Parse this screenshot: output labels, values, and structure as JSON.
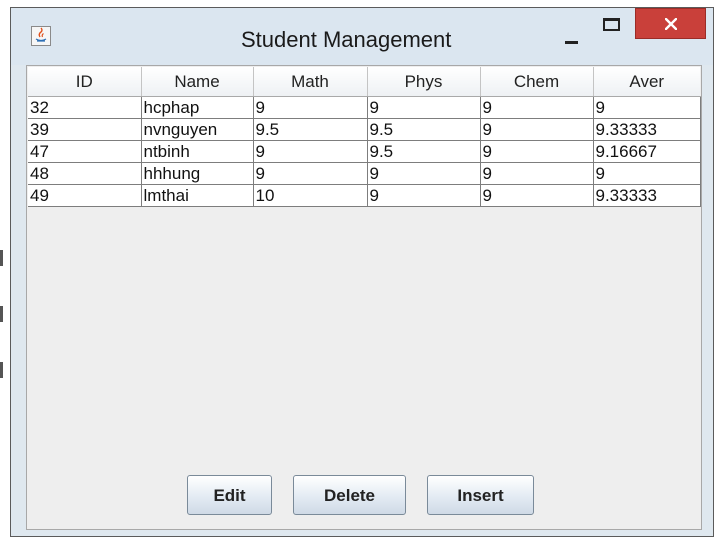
{
  "window": {
    "title": "Student Management",
    "controls": {
      "minimize": "minimize",
      "maximize": "maximize",
      "close": "close"
    }
  },
  "table": {
    "columns": [
      "ID",
      "Name",
      "Math",
      "Phys",
      "Chem",
      "Aver"
    ],
    "rows": [
      [
        "32",
        "hcphap",
        "9",
        "9",
        "9",
        "9"
      ],
      [
        "39",
        "nvnguyen",
        "9.5",
        "9.5",
        "9",
        "9.33333"
      ],
      [
        "47",
        "ntbinh",
        "9",
        "9.5",
        "9",
        "9.16667"
      ],
      [
        "48",
        "hhhung",
        "9",
        "9",
        "9",
        "9"
      ],
      [
        "49",
        "lmthai",
        "10",
        "9",
        "9",
        "9.33333"
      ]
    ]
  },
  "buttons": {
    "edit": "Edit",
    "delete": "Delete",
    "insert": "Insert"
  },
  "colors": {
    "close_button": "#c9403a",
    "window_frame": "#dfe8ef",
    "table_background": "#eeeeee"
  },
  "icons": {
    "app": "java-coffee-cup-icon",
    "close": "close-x-icon"
  }
}
